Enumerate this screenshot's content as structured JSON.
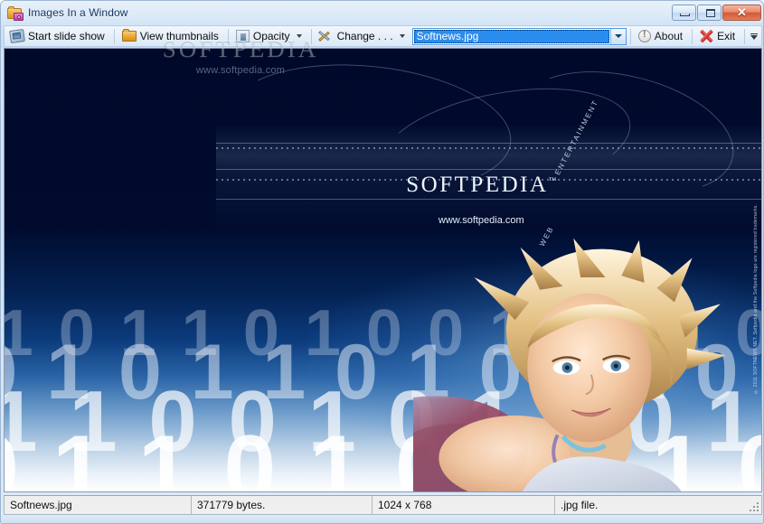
{
  "window": {
    "title": "Images In a Window",
    "icon": "folder-camera-icon",
    "controls": {
      "minimize": "minimize-button",
      "maximize": "maximize-button",
      "close": "close-button",
      "close_glyph": "✕"
    }
  },
  "toolbar": {
    "start_slideshow": "Start slide show",
    "view_thumbnails": "View thumbnails",
    "opacity": "Opacity",
    "change": "Change . . .",
    "about": "About",
    "exit": "Exit",
    "combo": {
      "value": "Softnews.jpg",
      "placeholder": "Softnews.jpg"
    }
  },
  "image": {
    "logo_text": "SOFTPEDIA",
    "logo_tm": "™",
    "url_text": "www.softpedia.com",
    "diagonal_left": "WEB",
    "diagonal_right": "ENTERTAINMENT",
    "vertical_copyright": "© 2011 SOFTNEWS NET. Softpedia and the Softpedia logo are registered trademarks.",
    "binary_rows": [
      "1 0 1 1 0 1 0 0 1 1 0 1 0 1",
      "0 1 0 1 1 0 1 0 0 1 0 1 1 0",
      "1 1 0 0 1 0 1 1 0 1 0 0 1 1",
      "0 1 1 0 1 0 0 1 1 0 1 1 0 1"
    ]
  },
  "watermark": {
    "title": "SOFTPEDIA",
    "url": "www.softpedia.com"
  },
  "statusbar": {
    "panels": [
      {
        "label": "Softnews.jpg"
      },
      {
        "label": "371779 bytes."
      },
      {
        "label": "1024 x 768"
      },
      {
        "label": ".jpg file."
      }
    ]
  }
}
